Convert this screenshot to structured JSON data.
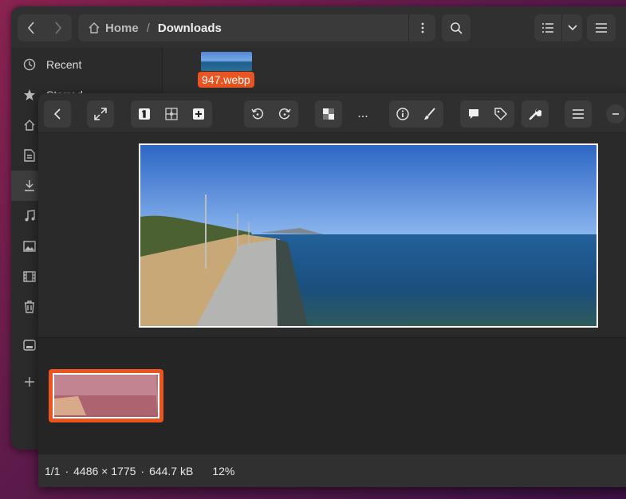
{
  "file_manager": {
    "path": {
      "home": "Home",
      "separator": "/",
      "current": "Downloads"
    },
    "sidebar": [
      {
        "label": "Recent",
        "icon": "clock-icon"
      },
      {
        "label": "Starred",
        "icon": "star-icon"
      }
    ],
    "file": {
      "name": "947.webp"
    }
  },
  "viewer": {
    "toolbar": {
      "more_label": "..."
    },
    "status": {
      "index": "1/1",
      "dot": "·",
      "dimensions": "4486 × 1775",
      "size": "644.7 kB",
      "zoom": "12%"
    }
  },
  "colors": {
    "accent": "#e95420",
    "window_bg": "#2b2b2b",
    "toolbar_bg": "#3c3c3c"
  }
}
